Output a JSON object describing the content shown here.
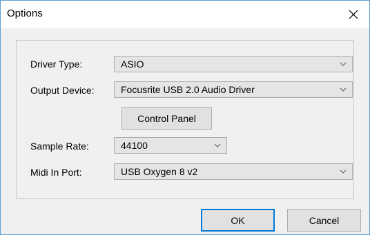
{
  "window": {
    "title": "Options"
  },
  "form": {
    "driver_type": {
      "label": "Driver Type:",
      "value": "ASIO"
    },
    "output_device": {
      "label": "Output Device:",
      "value": "Focusrite USB 2.0 Audio Driver"
    },
    "control_panel_label": "Control Panel",
    "sample_rate": {
      "label": "Sample Rate:",
      "value": "44100"
    },
    "midi_in_port": {
      "label": "Midi In Port:",
      "value": "USB Oxygen 8 v2"
    }
  },
  "buttons": {
    "ok": "OK",
    "cancel": "Cancel"
  },
  "icons": {
    "close": "close-icon",
    "dropdown": "chevron-down-icon"
  },
  "colors": {
    "window_border": "#5a9fd6",
    "default_button_border": "#0078d7",
    "dialog_background": "#f0f0f0"
  }
}
